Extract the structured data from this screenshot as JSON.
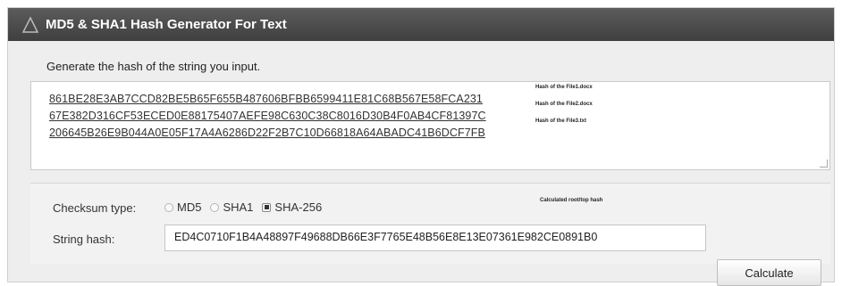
{
  "window": {
    "title": "MD5 & SHA1 Hash Generator For Text",
    "icon": "triangle-logo-icon"
  },
  "instruction": "Generate the hash of the string you input.",
  "input_text": {
    "lines": [
      "861BE28E3AB7CCD82BE5B65F655B487606BFBB6599411E81C68B567E58FCA231",
      "67E382D316CF53ECED0E88175407AEFE98C630C38C8016D30B4F0AB4CF81397C",
      "206645B26E9B044A0E05F17A4A6286D22F2B7C10D66818A64ABADC41B6DCF7FB"
    ],
    "annotations": [
      "Hash of the File1.docx",
      "Hash of the File2.docx",
      "Hash of the File3.txt"
    ]
  },
  "checksum": {
    "label": "Checksum type:",
    "options": [
      "MD5",
      "SHA1",
      "SHA-256"
    ],
    "selected": "SHA-256",
    "annotation": "Calculated root/top hash"
  },
  "string_hash": {
    "label": "String hash:",
    "value": "ED4C0710F1B4A48897F49688DB66E3F7765E48B56E8E13E07361E982CE0891B0"
  },
  "calculate_button": "Calculate"
}
